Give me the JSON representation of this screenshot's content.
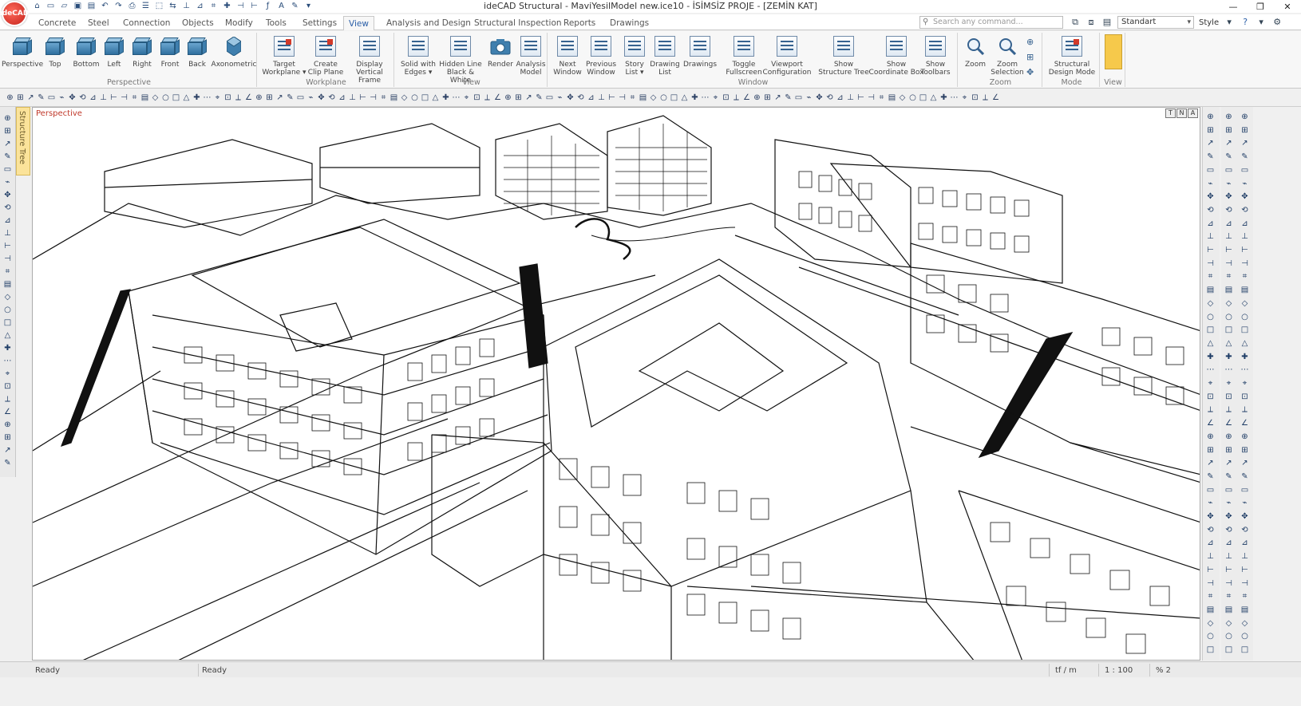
{
  "titlebar": {
    "logo": "ideCAD",
    "title": "ideCAD Structural - MaviYesilModel new.ice10 - İSİMSİZ PROJE - [ZEMİN KAT]",
    "minimize": "—",
    "maximize": "❐",
    "close": "✕"
  },
  "tabs": [
    "Concrete",
    "Steel",
    "Connection",
    "Objects",
    "Modify",
    "Tools",
    "Settings",
    "View",
    "Analysis and Design",
    "Structural Inspection",
    "Reports",
    "Drawings"
  ],
  "active_tab": "View",
  "search": {
    "placeholder": "Search any command..."
  },
  "style_select": {
    "value": "Standart",
    "label": "Style"
  },
  "ribbon": {
    "perspective": {
      "label": "Perspective",
      "buttons": [
        "Perspective",
        "Top",
        "Bottom",
        "Left",
        "Right",
        "Front",
        "Back",
        "Axonometric"
      ]
    },
    "workplane": {
      "label": "Workplane",
      "buttons": [
        {
          "l1": "Target",
          "l2": "Workplane ▾"
        },
        {
          "l1": "Create",
          "l2": "Clip Plane"
        },
        {
          "l1": "Display",
          "l2": "Vertical Frame"
        }
      ]
    },
    "view": {
      "label": "View",
      "buttons": [
        {
          "l1": "Solid with",
          "l2": "Edges ▾"
        },
        {
          "l1": "Hidden Line",
          "l2": "Black & White"
        },
        {
          "l1": "Render",
          "l2": ""
        },
        {
          "l1": "Analysis",
          "l2": "Model"
        }
      ]
    },
    "window": {
      "label": "Window",
      "buttons": [
        {
          "l1": "Next",
          "l2": "Window"
        },
        {
          "l1": "Previous",
          "l2": "Window"
        },
        {
          "l1": "Story",
          "l2": "List ▾"
        },
        {
          "l1": "Drawing",
          "l2": "List"
        },
        {
          "l1": "Drawings",
          "l2": ""
        },
        {
          "l1": "Toggle",
          "l2": "Fullscreen"
        },
        {
          "l1": "Viewport",
          "l2": "Configuration"
        },
        {
          "l1": "Show",
          "l2": "Structure Tree"
        },
        {
          "l1": "Show",
          "l2": "Coordinate Box"
        },
        {
          "l1": "Show",
          "l2": "Toolbars"
        }
      ]
    },
    "zoom": {
      "label": "Zoom",
      "buttons": [
        {
          "l1": "Zoom",
          "l2": ""
        },
        {
          "l1": "Zoom",
          "l2": "Selection"
        }
      ]
    },
    "mode": {
      "label": "Mode",
      "buttons": [
        {
          "l1": "Structural",
          "l2": "Design Mode"
        }
      ]
    },
    "viewgrp": {
      "label": "View"
    }
  },
  "viewport": {
    "label": "Perspective",
    "ctrl_labels": [
      "T",
      "N",
      "A"
    ]
  },
  "left_panel": {
    "structure_tree": "Structure Tree"
  },
  "status": {
    "left": "Ready",
    "mid": "Ready",
    "units": "tf / m",
    "scale": "1 : 100",
    "zoom": "% 2"
  },
  "icons": {
    "qat": [
      "home-icon",
      "new-icon",
      "open-icon",
      "save-icon",
      "save-all-icon",
      "undo-icon",
      "redo-icon"
    ],
    "accent": "#2b5fa8",
    "viewport_label_color": "#c0392b"
  }
}
